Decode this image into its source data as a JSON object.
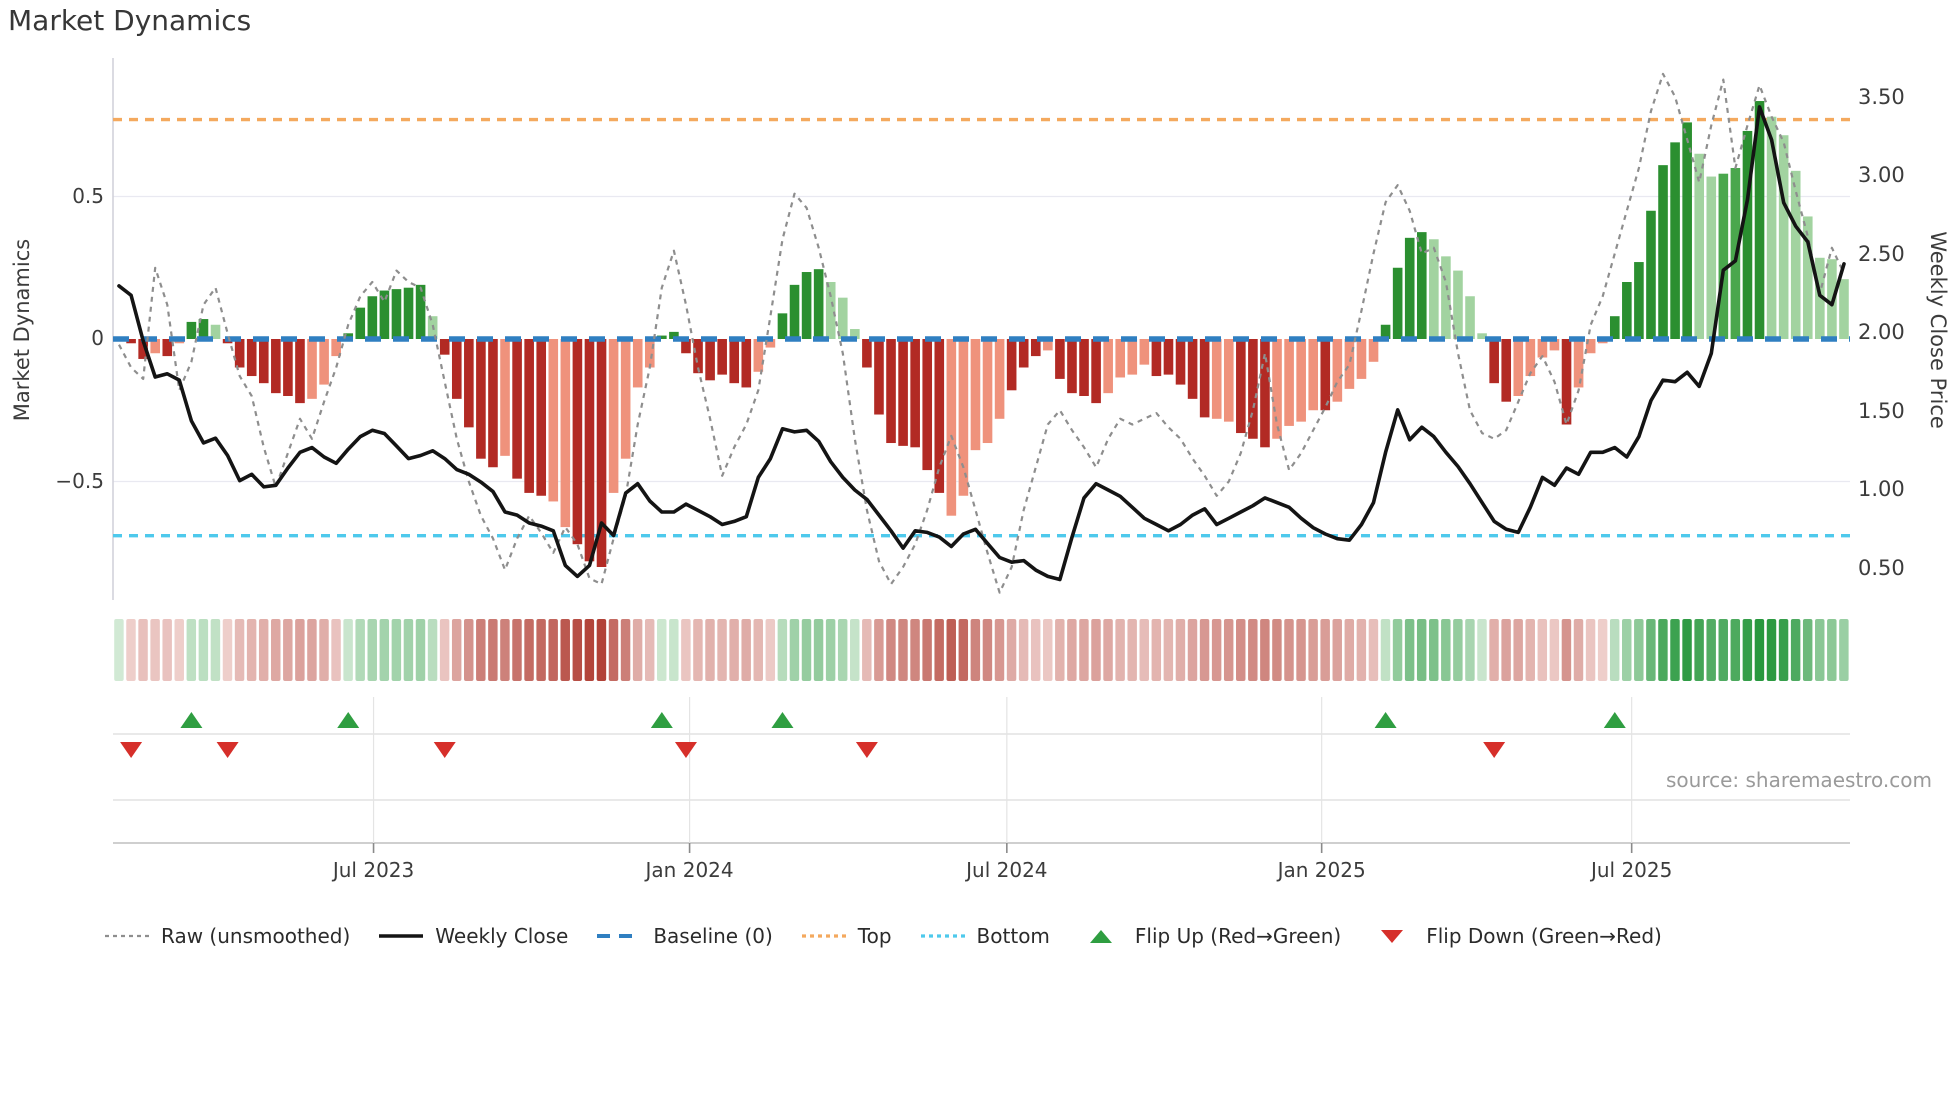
{
  "title": "Market Dynamics",
  "source": "source: sharemaestro.com",
  "legend": {
    "items": [
      {
        "label": "Raw (unsmoothed)",
        "swatch": "dash-gray",
        "key": "raw"
      },
      {
        "label": "Weekly Close",
        "swatch": "solid-black",
        "key": "weekly-close"
      },
      {
        "label": "Baseline (0)",
        "swatch": "dash-blue",
        "key": "baseline"
      },
      {
        "label": "Top",
        "swatch": "dot-orange",
        "key": "top"
      },
      {
        "label": "Bottom",
        "swatch": "dot-cyan",
        "key": "bottom"
      },
      {
        "label": "Flip Up (Red→Green)",
        "swatch": "tri-up-green",
        "key": "flip-up"
      },
      {
        "label": "Flip Down (Green→Red)",
        "swatch": "tri-down-red",
        "key": "flip-down"
      }
    ]
  },
  "colors": {
    "bar_dark_red": "#b22a24",
    "bar_salmon": "#ef927c",
    "bar_dark_green": "#2b8f30",
    "bar_mid_green": "#4aa74d",
    "bar_light_green": "#a2d3a0",
    "baseline_blue": "#2f7fc1",
    "top_orange": "#f4a95e",
    "bottom_cyan": "#4ec9ec",
    "raw_gray": "#8e8e8e",
    "close_black": "#141414",
    "grid": "#e9e9f1",
    "spine": "#cfcfd8",
    "sep_line": "#dcdcdc",
    "axis_line": "#bfbfbf",
    "vgrid": "#e4e4e4",
    "tick_mark": "#8a8a8a",
    "marker_green": "#2f9e41",
    "marker_red": "#d62f2a"
  },
  "chart_data": {
    "type": "bar+line",
    "title": "Market Dynamics",
    "left_axis": {
      "label": "Market Dynamics",
      "tick_labels": [
        "0.5",
        "0",
        "−0.5"
      ],
      "tick_values": [
        0.5,
        0,
        -0.5
      ],
      "range": [
        -0.95,
        0.98
      ]
    },
    "right_axis": {
      "label": "Weekly Close Price",
      "tick_labels": [
        "3.50",
        "3.00",
        "2.50",
        "2.00",
        "1.50",
        "1.00",
        "0.50"
      ],
      "tick_values": [
        3.5,
        3.0,
        2.5,
        2.0,
        1.5,
        1.0,
        0.5
      ]
    },
    "x_ticks": [
      {
        "label": "Jul 2023",
        "week": 21.1
      },
      {
        "label": "Jan 2024",
        "week": 47.3
      },
      {
        "label": "Jul 2024",
        "week": 73.6
      },
      {
        "label": "Jan 2025",
        "week": 99.7
      },
      {
        "label": "Jul 2025",
        "week": 125.4
      }
    ],
    "baseline": 0,
    "top_line": 0.77,
    "bottom_line": -0.69,
    "bars": [
      [
        0.0,
        "n"
      ],
      [
        -0.015,
        "r"
      ],
      [
        -0.07,
        "r"
      ],
      [
        -0.05,
        "s"
      ],
      [
        -0.06,
        "r"
      ],
      [
        -0.015,
        "s"
      ],
      [
        0.06,
        "g"
      ],
      [
        0.07,
        "g"
      ],
      [
        0.05,
        "l"
      ],
      [
        -0.015,
        "r"
      ],
      [
        -0.1,
        "r"
      ],
      [
        -0.13,
        "r"
      ],
      [
        -0.155,
        "r"
      ],
      [
        -0.19,
        "r"
      ],
      [
        -0.2,
        "r"
      ],
      [
        -0.225,
        "r"
      ],
      [
        -0.21,
        "s"
      ],
      [
        -0.16,
        "s"
      ],
      [
        -0.06,
        "s"
      ],
      [
        0.02,
        "g"
      ],
      [
        0.11,
        "g"
      ],
      [
        0.15,
        "g"
      ],
      [
        0.17,
        "g"
      ],
      [
        0.175,
        "g"
      ],
      [
        0.18,
        "g"
      ],
      [
        0.19,
        "g"
      ],
      [
        0.08,
        "l"
      ],
      [
        -0.055,
        "r"
      ],
      [
        -0.21,
        "r"
      ],
      [
        -0.31,
        "r"
      ],
      [
        -0.42,
        "r"
      ],
      [
        -0.45,
        "r"
      ],
      [
        -0.41,
        "s"
      ],
      [
        -0.49,
        "r"
      ],
      [
        -0.54,
        "r"
      ],
      [
        -0.55,
        "r"
      ],
      [
        -0.57,
        "s"
      ],
      [
        -0.66,
        "s"
      ],
      [
        -0.72,
        "r"
      ],
      [
        -0.78,
        "r"
      ],
      [
        -0.8,
        "r"
      ],
      [
        -0.54,
        "s"
      ],
      [
        -0.42,
        "s"
      ],
      [
        -0.17,
        "s"
      ],
      [
        -0.1,
        "s"
      ],
      [
        0.012,
        "g"
      ],
      [
        0.025,
        "g"
      ],
      [
        -0.05,
        "r"
      ],
      [
        -0.12,
        "r"
      ],
      [
        -0.145,
        "r"
      ],
      [
        -0.125,
        "r"
      ],
      [
        -0.155,
        "r"
      ],
      [
        -0.17,
        "r"
      ],
      [
        -0.115,
        "s"
      ],
      [
        -0.03,
        "s"
      ],
      [
        0.09,
        "g"
      ],
      [
        0.19,
        "g"
      ],
      [
        0.235,
        "g"
      ],
      [
        0.245,
        "g"
      ],
      [
        0.2,
        "l"
      ],
      [
        0.145,
        "l"
      ],
      [
        0.035,
        "l"
      ],
      [
        -0.1,
        "r"
      ],
      [
        -0.265,
        "r"
      ],
      [
        -0.365,
        "r"
      ],
      [
        -0.375,
        "r"
      ],
      [
        -0.38,
        "r"
      ],
      [
        -0.46,
        "r"
      ],
      [
        -0.54,
        "r"
      ],
      [
        -0.62,
        "s"
      ],
      [
        -0.55,
        "s"
      ],
      [
        -0.39,
        "s"
      ],
      [
        -0.365,
        "s"
      ],
      [
        -0.28,
        "s"
      ],
      [
        -0.18,
        "r"
      ],
      [
        -0.1,
        "r"
      ],
      [
        -0.06,
        "r"
      ],
      [
        -0.04,
        "s"
      ],
      [
        -0.14,
        "r"
      ],
      [
        -0.19,
        "r"
      ],
      [
        -0.2,
        "r"
      ],
      [
        -0.225,
        "r"
      ],
      [
        -0.19,
        "s"
      ],
      [
        -0.135,
        "s"
      ],
      [
        -0.125,
        "s"
      ],
      [
        -0.09,
        "s"
      ],
      [
        -0.13,
        "r"
      ],
      [
        -0.125,
        "r"
      ],
      [
        -0.16,
        "r"
      ],
      [
        -0.21,
        "r"
      ],
      [
        -0.275,
        "r"
      ],
      [
        -0.28,
        "s"
      ],
      [
        -0.29,
        "s"
      ],
      [
        -0.33,
        "r"
      ],
      [
        -0.35,
        "r"
      ],
      [
        -0.38,
        "r"
      ],
      [
        -0.35,
        "s"
      ],
      [
        -0.305,
        "s"
      ],
      [
        -0.29,
        "s"
      ],
      [
        -0.25,
        "s"
      ],
      [
        -0.25,
        "r"
      ],
      [
        -0.22,
        "s"
      ],
      [
        -0.175,
        "s"
      ],
      [
        -0.14,
        "s"
      ],
      [
        -0.08,
        "s"
      ],
      [
        0.05,
        "g"
      ],
      [
        0.25,
        "g"
      ],
      [
        0.355,
        "g"
      ],
      [
        0.375,
        "g"
      ],
      [
        0.35,
        "l"
      ],
      [
        0.29,
        "l"
      ],
      [
        0.24,
        "l"
      ],
      [
        0.15,
        "l"
      ],
      [
        0.02,
        "l"
      ],
      [
        -0.155,
        "r"
      ],
      [
        -0.22,
        "r"
      ],
      [
        -0.2,
        "s"
      ],
      [
        -0.13,
        "s"
      ],
      [
        -0.065,
        "s"
      ],
      [
        -0.04,
        "s"
      ],
      [
        -0.3,
        "r"
      ],
      [
        -0.17,
        "s"
      ],
      [
        -0.05,
        "s"
      ],
      [
        -0.015,
        "s"
      ],
      [
        0.08,
        "g"
      ],
      [
        0.2,
        "g"
      ],
      [
        0.27,
        "g"
      ],
      [
        0.45,
        "g"
      ],
      [
        0.61,
        "g"
      ],
      [
        0.69,
        "g"
      ],
      [
        0.76,
        "g"
      ],
      [
        0.65,
        "l"
      ],
      [
        0.57,
        "l"
      ],
      [
        0.58,
        "m"
      ],
      [
        0.6,
        "m"
      ],
      [
        0.73,
        "g"
      ],
      [
        0.835,
        "g"
      ],
      [
        0.78,
        "l"
      ],
      [
        0.715,
        "l"
      ],
      [
        0.59,
        "l"
      ],
      [
        0.43,
        "l"
      ],
      [
        0.285,
        "l"
      ],
      [
        0.28,
        "l"
      ],
      [
        0.21,
        "l"
      ]
    ],
    "raw": [
      -0.02,
      -0.1,
      -0.14,
      0.25,
      0.12,
      -0.18,
      -0.08,
      0.12,
      0.18,
      0.02,
      -0.13,
      -0.2,
      -0.38,
      -0.52,
      -0.4,
      -0.28,
      -0.35,
      -0.22,
      -0.1,
      0.05,
      0.15,
      0.2,
      0.13,
      0.24,
      0.2,
      0.18,
      0.05,
      -0.15,
      -0.35,
      -0.5,
      -0.62,
      -0.7,
      -0.81,
      -0.7,
      -0.62,
      -0.68,
      -0.75,
      -0.66,
      -0.72,
      -0.84,
      -0.86,
      -0.7,
      -0.55,
      -0.3,
      -0.1,
      0.18,
      0.31,
      0.12,
      -0.1,
      -0.28,
      -0.48,
      -0.38,
      -0.3,
      -0.18,
      0.08,
      0.35,
      0.51,
      0.46,
      0.32,
      0.15,
      -0.05,
      -0.35,
      -0.6,
      -0.78,
      -0.86,
      -0.8,
      -0.72,
      -0.6,
      -0.45,
      -0.34,
      -0.45,
      -0.6,
      -0.75,
      -0.89,
      -0.8,
      -0.6,
      -0.45,
      -0.3,
      -0.25,
      -0.32,
      -0.38,
      -0.45,
      -0.35,
      -0.28,
      -0.3,
      -0.28,
      -0.26,
      -0.31,
      -0.35,
      -0.42,
      -0.48,
      -0.55,
      -0.5,
      -0.4,
      -0.25,
      -0.05,
      -0.3,
      -0.46,
      -0.4,
      -0.32,
      -0.24,
      -0.15,
      -0.09,
      0.1,
      0.3,
      0.48,
      0.54,
      0.45,
      0.3,
      0.32,
      0.2,
      -0.05,
      -0.25,
      -0.33,
      -0.35,
      -0.32,
      -0.22,
      -0.12,
      -0.06,
      -0.15,
      -0.3,
      -0.18,
      0.05,
      0.15,
      0.3,
      0.45,
      0.6,
      0.8,
      0.93,
      0.85,
      0.7,
      0.55,
      0.75,
      0.91,
      0.6,
      0.75,
      0.89,
      0.78,
      0.69,
      0.52,
      0.36,
      0.16,
      0.32,
      0.23
    ],
    "weekly_close": [
      2.3,
      2.24,
      1.95,
      1.72,
      1.74,
      1.7,
      1.44,
      1.3,
      1.33,
      1.22,
      1.06,
      1.1,
      1.02,
      1.03,
      1.14,
      1.24,
      1.27,
      1.21,
      1.17,
      1.26,
      1.34,
      1.38,
      1.36,
      1.28,
      1.2,
      1.22,
      1.25,
      1.2,
      1.13,
      1.1,
      1.05,
      0.99,
      0.86,
      0.84,
      0.79,
      0.77,
      0.74,
      0.52,
      0.45,
      0.52,
      0.79,
      0.71,
      0.98,
      1.04,
      0.93,
      0.86,
      0.86,
      0.91,
      0.87,
      0.83,
      0.78,
      0.8,
      0.83,
      1.08,
      1.2,
      1.39,
      1.37,
      1.38,
      1.31,
      1.18,
      1.08,
      1.0,
      0.94,
      0.84,
      0.74,
      0.63,
      0.74,
      0.73,
      0.7,
      0.64,
      0.72,
      0.75,
      0.66,
      0.57,
      0.54,
      0.55,
      0.49,
      0.45,
      0.43,
      0.7,
      0.95,
      1.04,
      1.0,
      0.96,
      0.89,
      0.82,
      0.78,
      0.74,
      0.78,
      0.84,
      0.88,
      0.78,
      0.82,
      0.86,
      0.9,
      0.95,
      0.92,
      0.89,
      0.82,
      0.76,
      0.72,
      0.69,
      0.68,
      0.78,
      0.92,
      1.24,
      1.51,
      1.32,
      1.4,
      1.34,
      1.24,
      1.15,
      1.04,
      0.92,
      0.8,
      0.75,
      0.73,
      0.89,
      1.08,
      1.03,
      1.14,
      1.1,
      1.24,
      1.24,
      1.27,
      1.21,
      1.34,
      1.57,
      1.7,
      1.69,
      1.75,
      1.66,
      1.87,
      2.4,
      2.46,
      2.85,
      3.44,
      3.23,
      2.83,
      2.68,
      2.58,
      2.24,
      2.18,
      2.44
    ],
    "flip_up_weeks": [
      6,
      19,
      45,
      55,
      105,
      124
    ],
    "flip_down_weeks": [
      1,
      9,
      27,
      47,
      62,
      114
    ],
    "heatmap": "mirrors bar values: red-to-green intensity strip, one cell per week",
    "grid": "horizontal at 0.5 and -0.5",
    "legend_position": "bottom"
  }
}
